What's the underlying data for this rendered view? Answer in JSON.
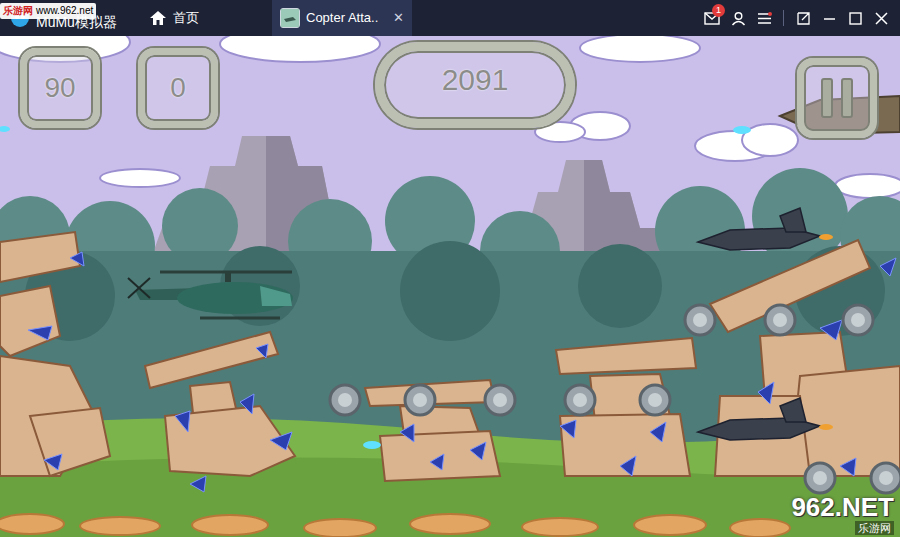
{
  "window": {
    "title": "MuMu模拟器",
    "mail_badge": "1"
  },
  "tabs": [
    {
      "label": "首页",
      "selected": false,
      "kind": "home"
    },
    {
      "label": "Copter Atta..",
      "selected": true,
      "kind": "app",
      "close": "✕"
    }
  ],
  "hud": {
    "health": "90",
    "kills": "0",
    "score": "2091"
  },
  "watermark": {
    "site_name": "乐游网",
    "url": "www.962.net",
    "brand": "962.NET",
    "brand_sub": "乐游网"
  }
}
